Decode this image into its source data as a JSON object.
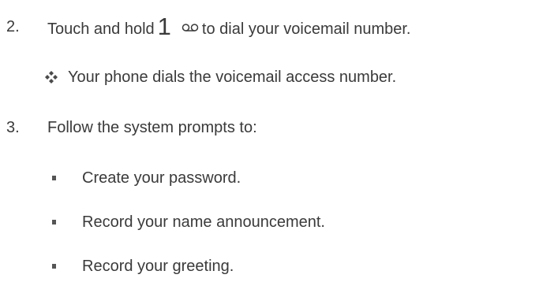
{
  "step2": {
    "number": "2.",
    "text_before": "Touch and hold",
    "key_digit": "1",
    "key_icon": "voicemail-icon",
    "text_after": "to dial your voicemail number."
  },
  "step2_result": {
    "icon": "diamond-bullet-icon",
    "text": "Your phone dials the voicemail access number."
  },
  "step3": {
    "number": "3.",
    "text": "Follow the system prompts to:"
  },
  "bullets": [
    "Create your password.",
    "Record your name announcement.",
    "Record your greeting."
  ],
  "colors": {
    "text": "#3a3a3a",
    "bullet": "#555555"
  }
}
